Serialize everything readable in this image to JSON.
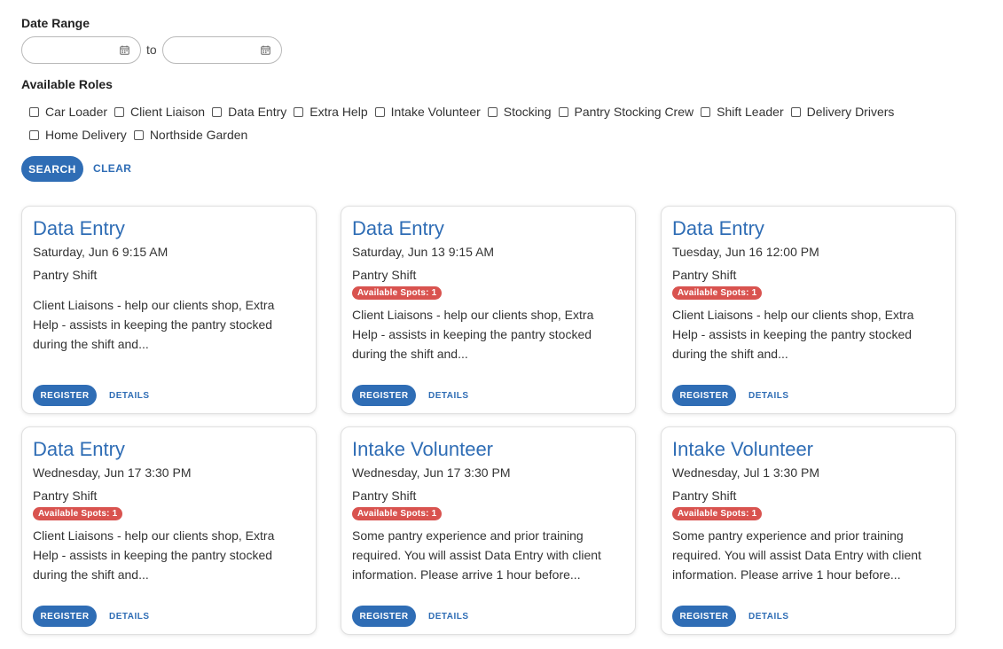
{
  "filters": {
    "date_range_label": "Date Range",
    "date_from_value": "",
    "to_label": "to",
    "date_to_value": "",
    "roles_label": "Available Roles",
    "roles_row1": [
      "Car Loader",
      "Client Liaison",
      "Data Entry",
      "Extra Help",
      "Intake Volunteer",
      "Stocking",
      "Pantry Stocking Crew",
      "Shift Leader",
      "Delivery Drivers"
    ],
    "roles_row2": [
      "Home Delivery",
      "Northside Garden"
    ],
    "search_label": "SEARCH",
    "clear_label": "CLEAR"
  },
  "cards": [
    {
      "title": "Data Entry",
      "date": "Saturday, Jun 6 9:15 AM",
      "type": "Pantry Shift",
      "badge": "",
      "desc": "Client Liaisons - help our clients shop, Extra Help - assists in keeping the pantry stocked during the shift and...",
      "register": "REGISTER",
      "details": "DETAILS"
    },
    {
      "title": "Data Entry",
      "date": "Saturday, Jun 13 9:15 AM",
      "type": "Pantry Shift",
      "badge": "Available Spots: 1",
      "desc": "Client Liaisons - help our clients shop, Extra Help - assists in keeping the pantry stocked during the shift and...",
      "register": "REGISTER",
      "details": "DETAILS"
    },
    {
      "title": "Data Entry",
      "date": "Tuesday, Jun 16 12:00 PM",
      "type": "Pantry Shift",
      "badge": "Available Spots: 1",
      "desc": "Client Liaisons - help our clients shop, Extra Help - assists in keeping the pantry stocked during the shift and...",
      "register": "REGISTER",
      "details": "DETAILS"
    },
    {
      "title": "Data Entry",
      "date": "Wednesday, Jun 17 3:30 PM",
      "type": "Pantry Shift",
      "badge": "Available Spots: 1",
      "desc": "Client Liaisons - help our clients shop, Extra Help - assists in keeping the pantry stocked during the shift and...",
      "register": "REGISTER",
      "details": "DETAILS"
    },
    {
      "title": "Intake Volunteer",
      "date": "Wednesday, Jun 17 3:30 PM",
      "type": "Pantry Shift",
      "badge": "Available Spots: 1",
      "desc": "Some pantry experience and prior training required. You will assist Data Entry with client information. Please arrive 1 hour before...",
      "register": "REGISTER",
      "details": "DETAILS"
    },
    {
      "title": "Intake Volunteer",
      "date": "Wednesday, Jul 1 3:30 PM",
      "type": "Pantry Shift",
      "badge": "Available Spots: 1",
      "desc": "Some pantry experience and prior training required. You will assist Data Entry with client information. Please arrive 1 hour before...",
      "register": "REGISTER",
      "details": "DETAILS"
    }
  ],
  "icons": {
    "calendar": "calendar-icon",
    "checkbox": "checkbox-unchecked"
  },
  "colors": {
    "accent": "#2f6db5",
    "badge": "#d9534f"
  }
}
